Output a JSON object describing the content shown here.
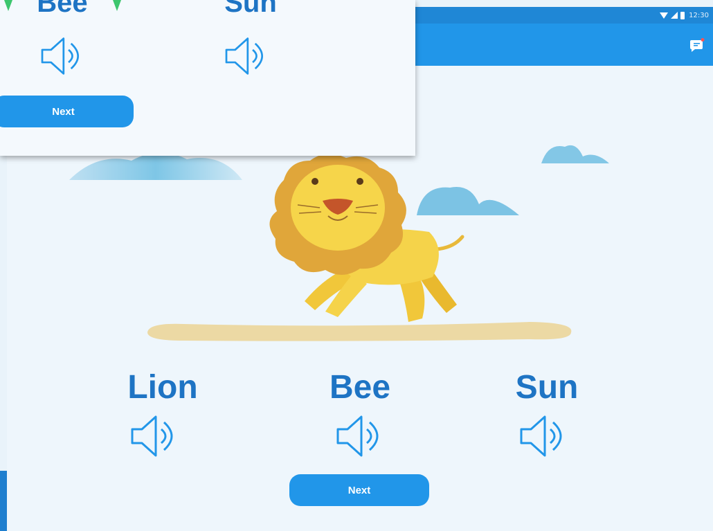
{
  "status_bar": {
    "time": "12:30"
  },
  "colors": {
    "primary": "#2196e9",
    "status_bar": "#1f87d6",
    "word": "#1e74c4",
    "background": "#eef6fc",
    "lion_body": "#f5d34a",
    "lion_mane": "#e0a63a",
    "ground": "#ecd9a4"
  },
  "icons": {
    "chat": "chat-notification-icon",
    "speaker": "speaker-icon",
    "wifi": "wifi-icon",
    "signal": "signal-icon",
    "battery": "battery-icon"
  },
  "main": {
    "words": [
      "Lion",
      "Bee",
      "Sun"
    ],
    "next_label": "Next"
  },
  "overlay": {
    "words": [
      "Bee",
      "Sun"
    ],
    "next_label": "Next"
  }
}
